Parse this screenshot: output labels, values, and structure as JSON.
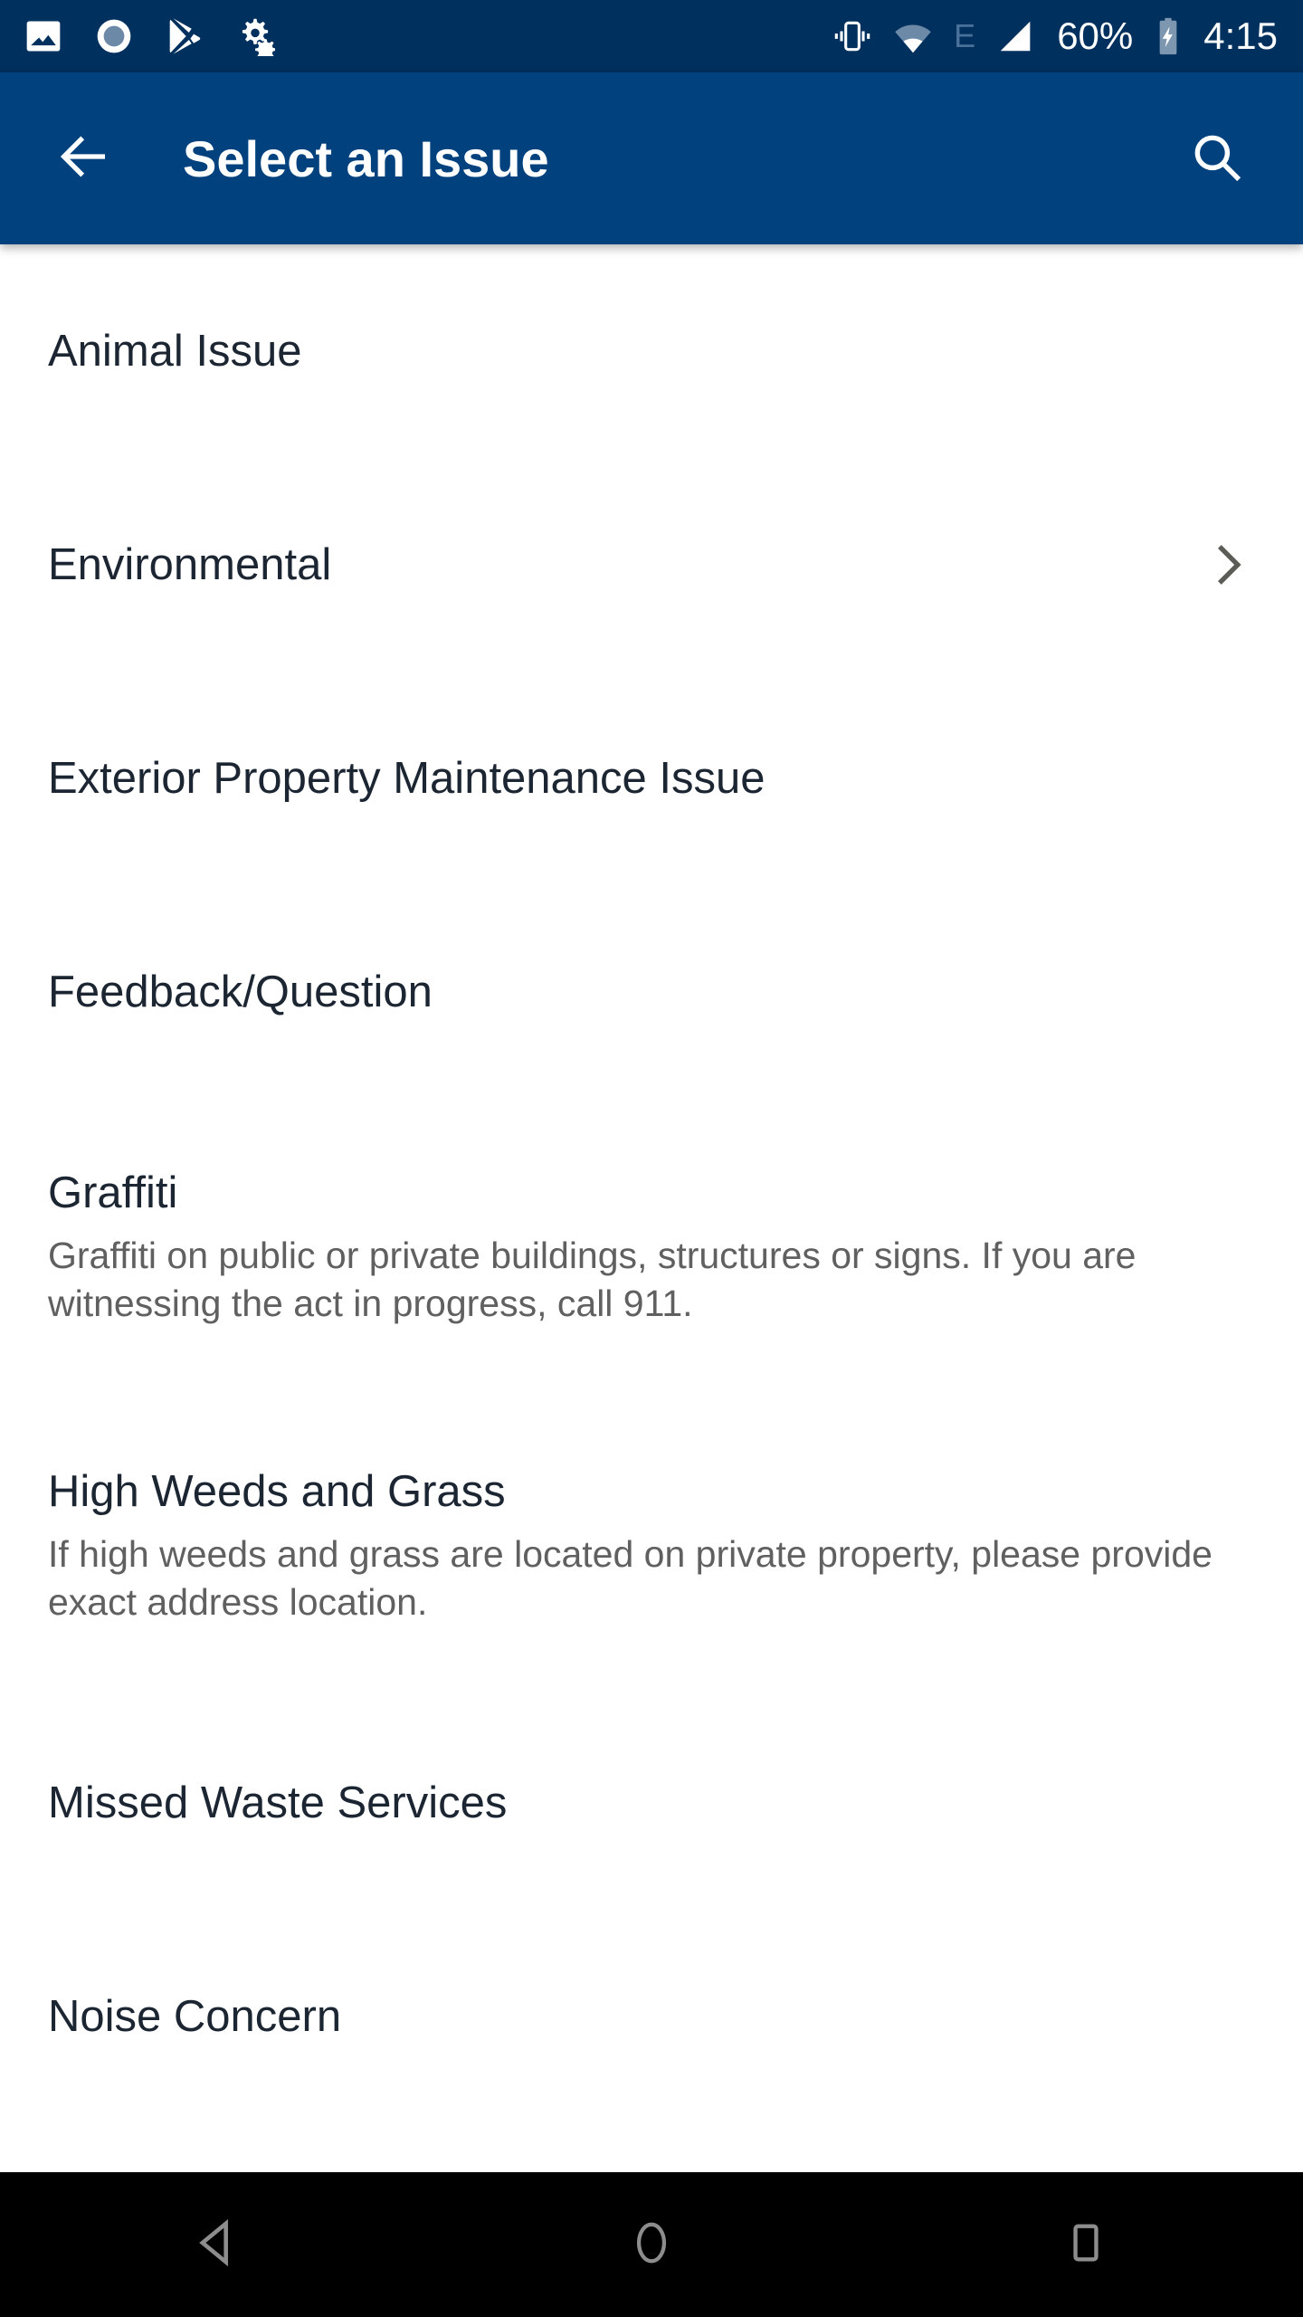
{
  "status_bar": {
    "background": "#00305e",
    "left_icons": [
      "image-icon",
      "record-icon",
      "play-store-icon",
      "settings-gear-icon"
    ],
    "right_icons": [
      "vibrate-icon",
      "wifi-icon",
      "signal-icon",
      "battery-charging-icon"
    ],
    "network_type": "E",
    "battery_percent": "60%",
    "clock": "4:15"
  },
  "app_bar": {
    "background": "#01427e",
    "back_icon": "back-arrow-icon",
    "title": "Select an Issue",
    "search_icon": "search-icon"
  },
  "list": {
    "items": [
      {
        "title": "Animal Issue",
        "desc": "",
        "chevron": false
      },
      {
        "title": "Environmental",
        "desc": "",
        "chevron": true
      },
      {
        "title": "Exterior Property Maintenance Issue",
        "desc": "",
        "chevron": false
      },
      {
        "title": "Feedback/Question",
        "desc": "",
        "chevron": false
      },
      {
        "title": "Graffiti",
        "desc": "Graffiti on public or private buildings, structures or signs.  If you are witnessing the act in progress, call 911.",
        "chevron": false
      },
      {
        "title": "High Weeds and Grass",
        "desc": "If high weeds and grass are located on private property, please provide exact address location.",
        "chevron": false
      },
      {
        "title": "Missed Waste Services",
        "desc": "",
        "chevron": false
      },
      {
        "title": "Noise Concern",
        "desc": "",
        "chevron": false
      }
    ]
  },
  "nav_bar": {
    "background": "#000000",
    "buttons": [
      "back-triangle-icon",
      "home-circle-icon",
      "recents-square-icon"
    ]
  }
}
